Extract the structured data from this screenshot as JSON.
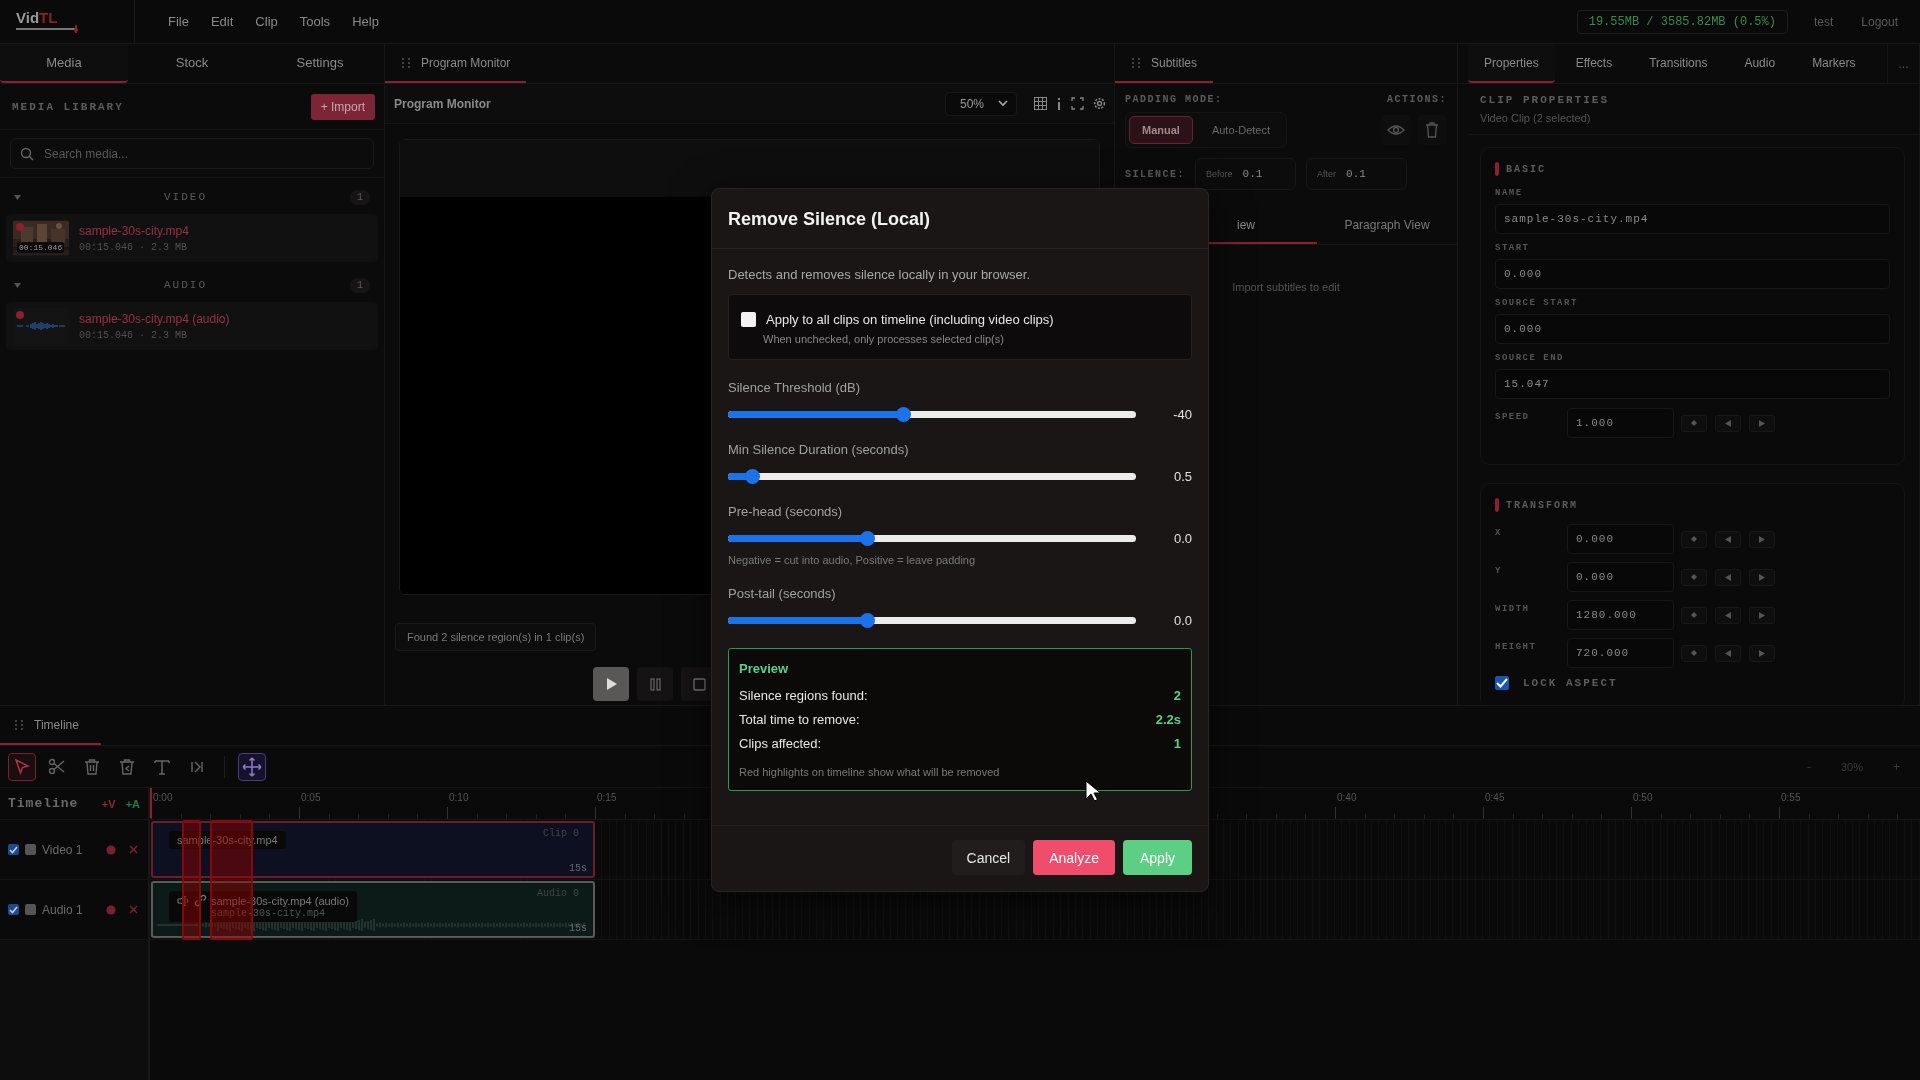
{
  "app": {
    "logo_main": "Vid",
    "logo_accent": "TL"
  },
  "menu": [
    "File",
    "Edit",
    "Clip",
    "Tools",
    "Help"
  ],
  "header": {
    "memory": "19.55MB / 3585.82MB (0.5%)",
    "user": "test",
    "logout": "Logout"
  },
  "left_panel": {
    "tabs": [
      {
        "label": "Media",
        "selected": true
      },
      {
        "label": "Stock",
        "selected": false
      },
      {
        "label": "Settings",
        "selected": false
      }
    ],
    "title": "MEDIA LIBRARY",
    "import_button": "+ Import",
    "search": {
      "placeholder": "Search media..."
    },
    "sections": [
      {
        "title": "VIDEO",
        "count": "1",
        "expanded": true,
        "items": [
          {
            "kind": "video",
            "name": "sample-30s-city.mp4",
            "duration_badge": "00:15.046",
            "meta": "00:15.046 · 2.3 MB"
          }
        ]
      },
      {
        "title": "AUDIO",
        "count": "1",
        "expanded": true,
        "items": [
          {
            "kind": "audio",
            "name": "sample-30s-city.mp4 (audio)",
            "meta": "00:15.046 · 2.3 MB"
          }
        ]
      }
    ]
  },
  "monitor": {
    "tab": "Program Monitor",
    "title": "Program Monitor",
    "zoom": "50%",
    "status": "Found 2 silence region(s) in 1 clip(s)"
  },
  "subtitles": {
    "tab": "Subtitles",
    "padding_label": "PADDING MODE:",
    "actions_label": "ACTIONS:",
    "modes": [
      {
        "label": "Manual",
        "selected": true
      },
      {
        "label": "Auto-Detect",
        "selected": false
      }
    ],
    "silence_label": "SILENCE:",
    "fields": [
      {
        "label": "Before",
        "value": "0.1"
      },
      {
        "label": "After",
        "value": "0.1"
      }
    ],
    "views": [
      {
        "label": "iew",
        "selected": true
      },
      {
        "label": "Paragraph View",
        "selected": false
      }
    ],
    "empty": "Import subtitles to edit"
  },
  "properties": {
    "tabs": [
      {
        "label": "Properties",
        "selected": true
      },
      {
        "label": "Effects",
        "selected": false
      },
      {
        "label": "Transitions",
        "selected": false
      },
      {
        "label": "Audio",
        "selected": false
      },
      {
        "label": "Markers",
        "selected": false
      }
    ],
    "more": "...",
    "heading": "CLIP PROPERTIES",
    "subheading": "Video Clip (2 selected)",
    "sections": [
      {
        "title": "BASIC",
        "fields": [
          {
            "kind": "wide",
            "label": "NAME",
            "value": "sample-30s-city.mp4"
          },
          {
            "kind": "wide",
            "label": "START",
            "value": "0.000"
          },
          {
            "kind": "wide",
            "label": "SOURCE START",
            "value": "0.000"
          },
          {
            "kind": "wide",
            "label": "SOURCE END",
            "value": "15.047"
          },
          {
            "kind": "keyframe",
            "label": "SPEED",
            "value": "1.000"
          }
        ]
      },
      {
        "title": "TRANSFORM",
        "fields": [
          {
            "kind": "keyframe",
            "label": "X",
            "value": "0.000"
          },
          {
            "kind": "keyframe",
            "label": "Y",
            "value": "0.000"
          },
          {
            "kind": "keyframe",
            "label": "WIDTH",
            "value": "1280.000"
          },
          {
            "kind": "keyframe",
            "label": "HEIGHT",
            "value": "720.000"
          },
          {
            "kind": "check",
            "label": "LOCK ASPECT",
            "checked": true
          }
        ]
      }
    ]
  },
  "timeline": {
    "tab": "Timeline",
    "label": "Timeline",
    "add_video": "+V",
    "add_audio": "+A",
    "tools": [
      {
        "kind": "select",
        "selected": true
      },
      {
        "kind": "cut",
        "selected": false
      },
      {
        "kind": "delete",
        "selected": false
      },
      {
        "kind": "ripple-delete",
        "selected": false
      },
      {
        "kind": "text",
        "selected": false
      },
      {
        "kind": "trim",
        "selected": false
      }
    ],
    "snap": {
      "on": true
    },
    "zoom_out": "-",
    "zoom": "30%",
    "zoom_in": "+",
    "ruler_left": [
      "0:00",
      "0:05",
      "0:10",
      "0:15"
    ],
    "ruler_right": [
      "0:40",
      "0:45",
      "0:50",
      "0:55"
    ],
    "tracks": [
      {
        "kind": "video",
        "name": "Video 1",
        "checked": true,
        "clip": {
          "name": "sample-30s-city.mp4",
          "tag": "Clip 0",
          "length": "15s",
          "selected": true
        }
      },
      {
        "kind": "audio",
        "name": "Audio 1",
        "checked": true,
        "clip": {
          "name": "sample-30s-city.mp4 (audio)",
          "source": "sample-30s-city.mp4",
          "tag": "Audio 0",
          "length": "15s",
          "selected": false
        }
      }
    ]
  },
  "dialog": {
    "title": "Remove Silence (Local)",
    "description": "Detects and removes silence locally in your browser.",
    "apply_all": {
      "label": "Apply to all clips on timeline (including video clips)",
      "hint": "When unchecked, only processes selected clip(s)",
      "checked": false
    },
    "sliders": [
      {
        "label": "Silence Threshold (dB)",
        "level": 0.43,
        "reading": "-40"
      },
      {
        "label": "Min Silence Duration (seconds)",
        "level": 0.06,
        "reading": "0.5"
      },
      {
        "label": "Pre-head (seconds)",
        "level": 0.34,
        "reading": "0.0",
        "hint": "Negative = cut into audio, Positive = leave padding"
      },
      {
        "label": "Post-tail (seconds)",
        "level": 0.34,
        "reading": "0.0"
      }
    ],
    "preview": {
      "title": "Preview",
      "rows": [
        {
          "label": "Silence regions found:",
          "value": "2"
        },
        {
          "label": "Total time to remove:",
          "value": "2.2s"
        },
        {
          "label": "Clips affected:",
          "value": "1"
        }
      ],
      "note": "Red highlights on timeline show what will be removed"
    },
    "buttons": [
      {
        "kind": "cancel",
        "label": "Cancel"
      },
      {
        "kind": "analyze",
        "label": "Analyze"
      },
      {
        "kind": "apply",
        "label": "Apply"
      }
    ]
  }
}
